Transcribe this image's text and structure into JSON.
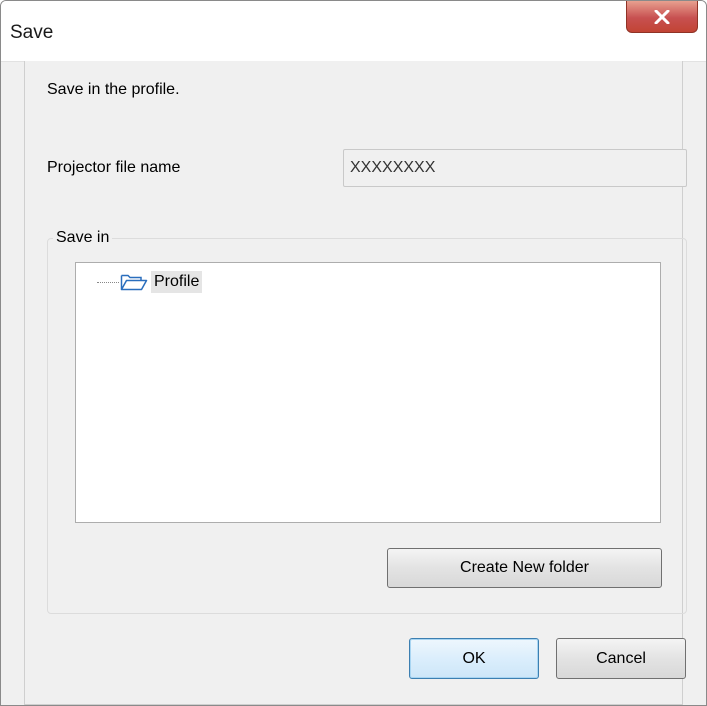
{
  "window": {
    "title": "Save",
    "close_label": "X"
  },
  "dialog": {
    "instruction": "Save in the profile.",
    "filename_label": "Projector file name",
    "filename_value": "XXXXXXXX",
    "group_label": "Save in",
    "tree": {
      "items": [
        {
          "label": "Profile",
          "icon": "folder-open-icon",
          "selected": true
        }
      ]
    },
    "create_folder_label": "Create New folder",
    "ok_label": "OK",
    "cancel_label": "Cancel"
  },
  "colors": {
    "close_button": "#c75050",
    "folder_icon": "#2a6ebd",
    "ok_border": "#3c7fb1"
  }
}
